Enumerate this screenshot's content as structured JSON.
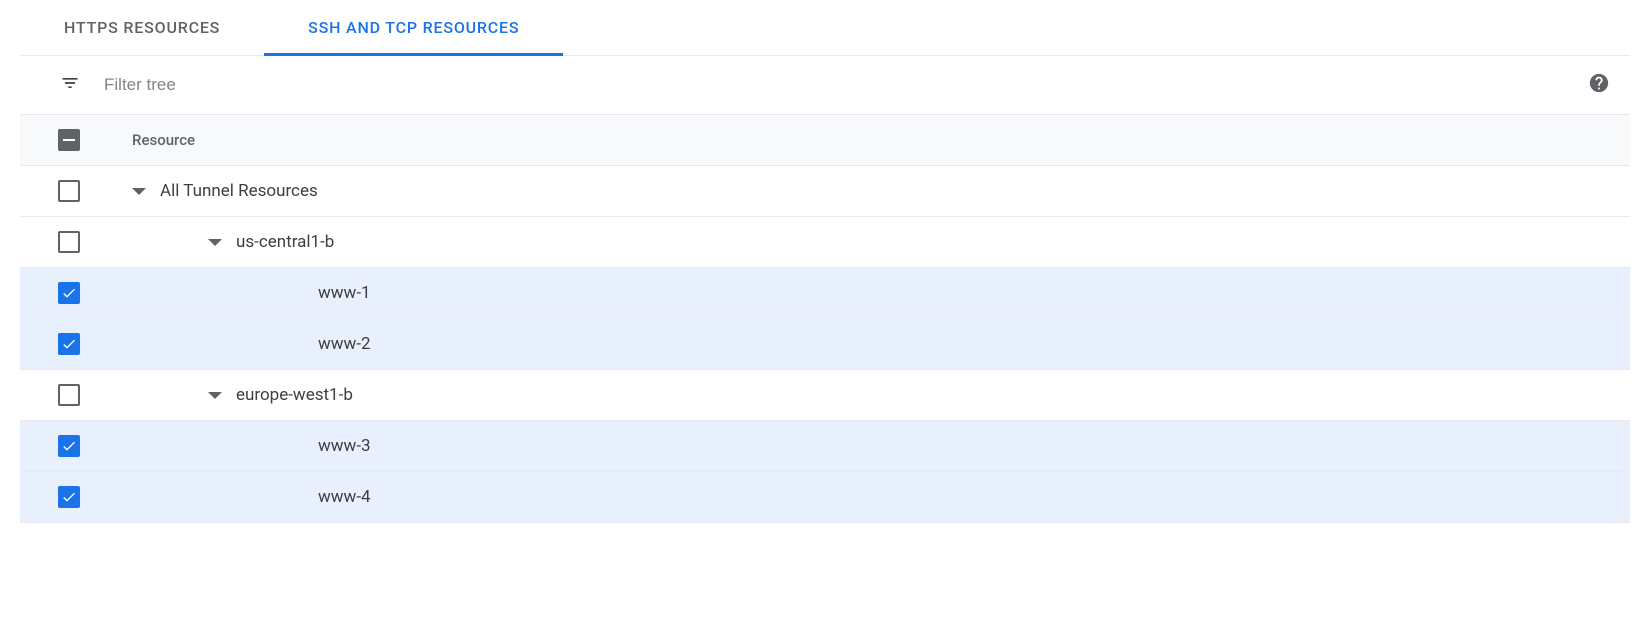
{
  "tabs": {
    "https": {
      "label": "HTTPS RESOURCES",
      "active": false
    },
    "ssh": {
      "label": "SSH AND TCP RESOURCES",
      "active": true
    }
  },
  "filter": {
    "placeholder": "Filter tree"
  },
  "header": {
    "resource": "Resource"
  },
  "tree": {
    "root": {
      "label": "All Tunnel Resources"
    },
    "zone1": {
      "label": "us-central1-b"
    },
    "vm1": {
      "label": "www-1"
    },
    "vm2": {
      "label": "www-2"
    },
    "zone2": {
      "label": "europe-west1-b"
    },
    "vm3": {
      "label": "www-3"
    },
    "vm4": {
      "label": "www-4"
    }
  }
}
